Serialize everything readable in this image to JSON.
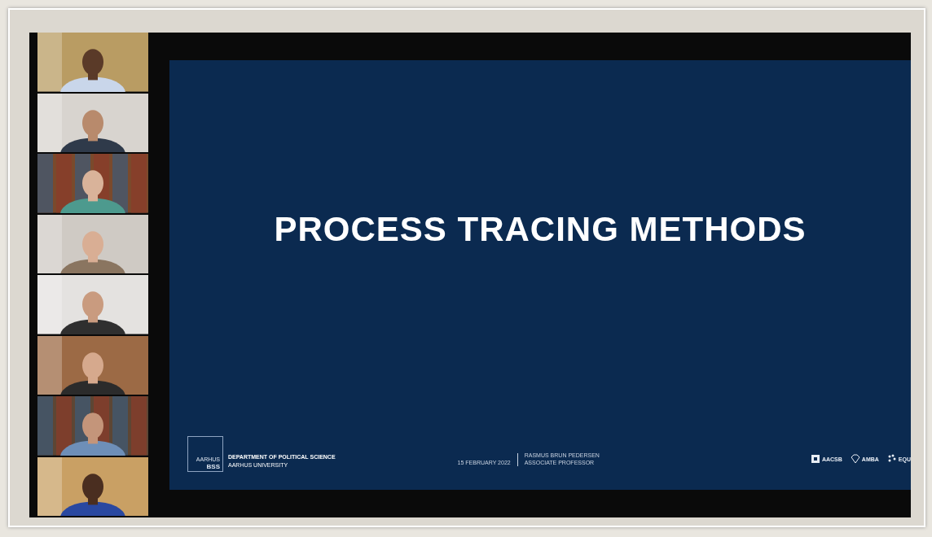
{
  "slide": {
    "title": "PROCESS TRACING METHODS",
    "logo": {
      "line_1": "AARHUS",
      "line_2": "BSS"
    },
    "department": "DEPARTMENT OF POLITICAL SCIENCE",
    "university": "AARHUS UNIVERSITY",
    "date": "15 FEBRUARY 2022",
    "presenter": "RASMUS BRUN PEDERSEN",
    "role": "ASSOCIATE PROFESSOR",
    "accreditations": [
      "AACSB",
      "AMBA",
      "EQU"
    ]
  }
}
